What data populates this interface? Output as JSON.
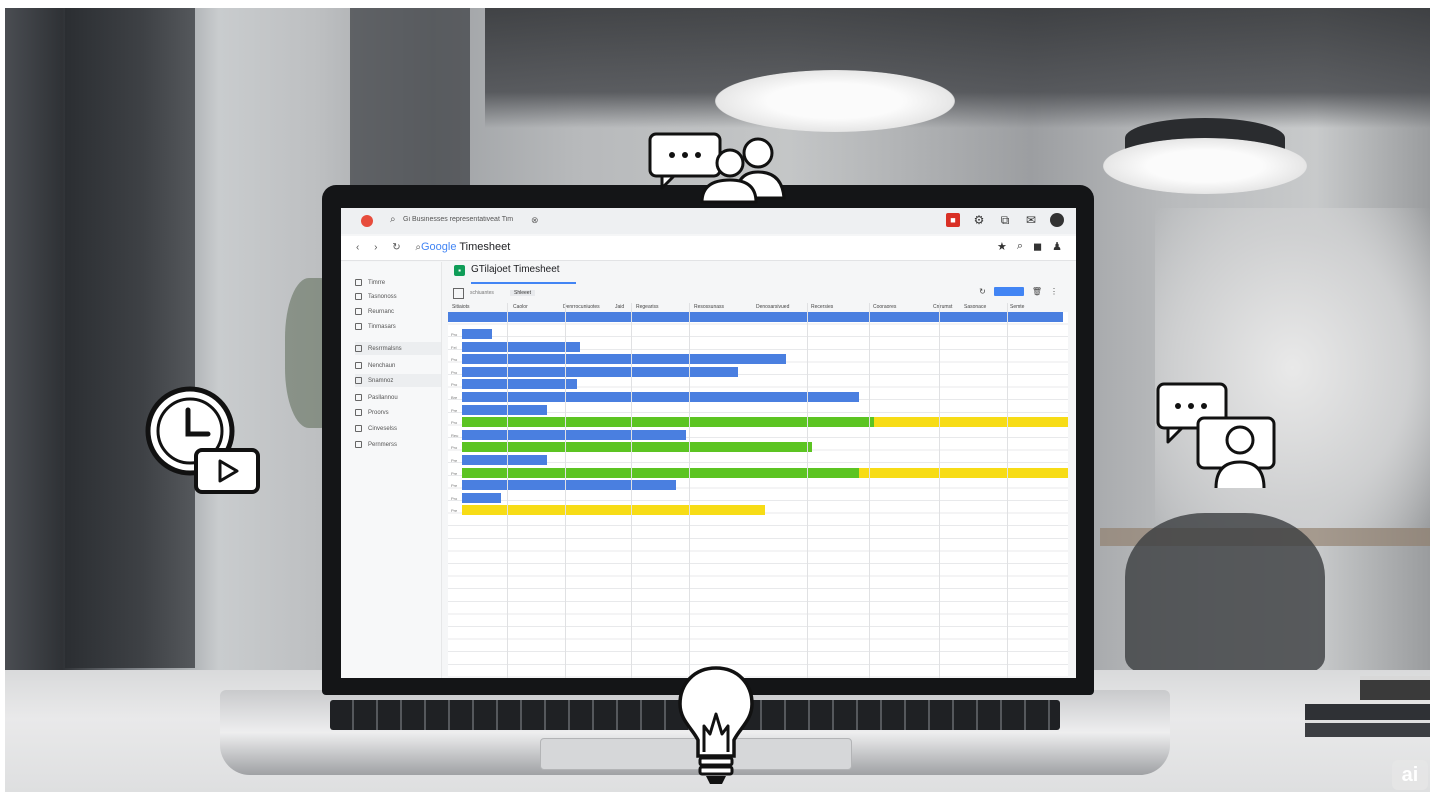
{
  "browser": {
    "tab_title": "Gi Businesses representativeat Timesheet",
    "tab_close": "⊗",
    "address_brand": "Google",
    "address_suffix": " Timesheet",
    "nav_symbols": "‹ › ↻ ⌕"
  },
  "sheet": {
    "title": "GTilajoet Timesheet",
    "toolbar_label_1": "schiuantes",
    "toolbar_label_2": "Shleeet",
    "column_headers": [
      "Sitiaiots",
      "Caolor",
      "Denrrocuniuotes",
      "Jaid",
      "Regeariss",
      "Resossunass",
      "Denosarsivued",
      "Recersies",
      "Cooraores",
      "Crrrumst",
      "Sasonace",
      "Semte"
    ]
  },
  "sidebar": {
    "items": [
      {
        "label": "Timrre",
        "icon": "settings-icon"
      },
      {
        "label": "Tasnonoss",
        "icon": "clock-icon"
      },
      {
        "label": "Reurnanc",
        "icon": "gear-icon"
      },
      {
        "label": "Tinmasars",
        "icon": "calendar-icon"
      },
      {
        "label": "Resrrmalsns",
        "icon": "grid-icon"
      },
      {
        "label": "Nenchaun",
        "icon": "doc-icon"
      },
      {
        "label": "Snamnoz",
        "icon": "search-icon"
      },
      {
        "label": "Pasllannou",
        "icon": "doc-icon"
      },
      {
        "label": "Proorvs",
        "icon": "lock-icon"
      },
      {
        "label": "Cinveselss",
        "icon": "doc-icon"
      },
      {
        "label": "Pernmerss",
        "icon": "grid-icon"
      }
    ]
  },
  "rows": [
    {
      "label": "Pro",
      "color": "blue",
      "start": 0.0,
      "end": 0.05
    },
    {
      "label": "Fel",
      "color": "blue",
      "start": 0.0,
      "end": 0.195
    },
    {
      "label": "Pro",
      "color": "blue",
      "start": 0.0,
      "end": 0.535
    },
    {
      "label": "Pro",
      "color": "blue",
      "start": 0.0,
      "end": 0.455
    },
    {
      "label": "Pro",
      "color": "blue",
      "start": 0.0,
      "end": 0.19
    },
    {
      "label": "Bre",
      "color": "blue",
      "start": 0.0,
      "end": 0.655
    },
    {
      "label": "Pre",
      "color": "blue",
      "start": 0.0,
      "end": 0.14
    },
    {
      "label": "Pro",
      "color": "green",
      "start": 0.0,
      "end": 0.68,
      "yellow_end": 1.0
    },
    {
      "label": "Reu",
      "color": "blue",
      "start": 0.0,
      "end": 0.37
    },
    {
      "label": "Pro",
      "color": "green",
      "start": 0.0,
      "end": 0.578
    },
    {
      "label": "Pre",
      "color": "blue",
      "start": 0.0,
      "end": 0.14
    },
    {
      "label": "Pre",
      "color": "green",
      "start": 0.0,
      "end": 0.655,
      "yellow_end": 1.0
    },
    {
      "label": "Pre",
      "color": "blue",
      "start": 0.0,
      "end": 0.353
    },
    {
      "label": "Pro",
      "color": "blue",
      "start": 0.0,
      "end": 0.065
    },
    {
      "label": "Pre",
      "color": "yellow",
      "start": 0.0,
      "end": 0.5
    }
  ],
  "overlay": {
    "chat_dots": "•••",
    "watermark": "ai"
  },
  "colors": {
    "blue": "#4a7fe0",
    "green": "#5cc422",
    "yellow": "#f7dc16",
    "sheets_green": "#0f9d58"
  }
}
